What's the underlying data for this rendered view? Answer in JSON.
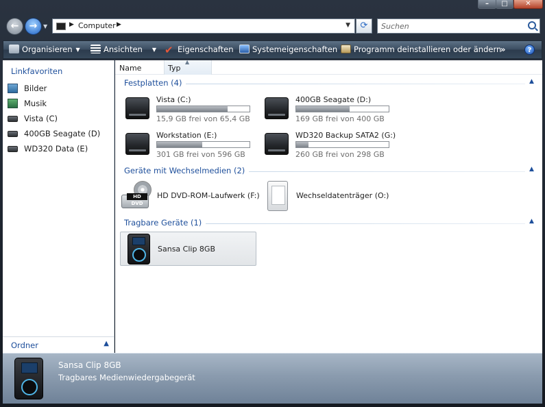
{
  "window": {
    "controls": [
      "–",
      "□",
      "✕"
    ]
  },
  "nav": {
    "address": "Computer",
    "search_placeholder": "Suchen"
  },
  "toolbar": {
    "organize": "Organisieren",
    "views": "Ansichten",
    "properties": "Eigenschaften",
    "system_properties": "Systemeigenschaften",
    "uninstall": "Programm deinstallieren oder ändern",
    "more": "»",
    "help": "?"
  },
  "sidebar": {
    "title": "Linkfavoriten",
    "items": [
      {
        "label": "Bilder",
        "icon": "pictures-icon"
      },
      {
        "label": "Musik",
        "icon": "music-icon"
      },
      {
        "label": "Vista (C)",
        "icon": "drive-icon"
      },
      {
        "label": "400GB Seagate (D)",
        "icon": "drive-icon"
      },
      {
        "label": "WD320 Data (E)",
        "icon": "drive-icon"
      }
    ],
    "folders_label": "Ordner"
  },
  "columns": {
    "name": "Name",
    "type": "Typ"
  },
  "groups": {
    "harddisks": "Festplatten (4)",
    "removable": "Geräte mit Wechselmedien (2)",
    "portable": "Tragbare Geräte (1)"
  },
  "drives": [
    {
      "name": "Vista (C:)",
      "free": "15,9 GB frei von 65,4 GB",
      "used_fraction": 0.76
    },
    {
      "name": "400GB Seagate (D:)",
      "free": "169 GB frei von 400 GB",
      "used_fraction": 0.58
    },
    {
      "name": "Workstation (E:)",
      "free": "301 GB frei von 596 GB",
      "used_fraction": 0.49
    },
    {
      "name": "WD320 Backup SATA2 (G:)",
      "free": "260 GB frei von 298 GB",
      "used_fraction": 0.13
    }
  ],
  "devices": [
    {
      "name": "HD DVD-ROM-Laufwerk (F:)",
      "badge": "HD DVD"
    },
    {
      "name": "Wechseldatenträger (O:)"
    }
  ],
  "portable": {
    "name": "Sansa Clip 8GB"
  },
  "details": {
    "title": "Sansa Clip 8GB",
    "subtitle": "Tragbares Medienwiedergabegerät"
  }
}
